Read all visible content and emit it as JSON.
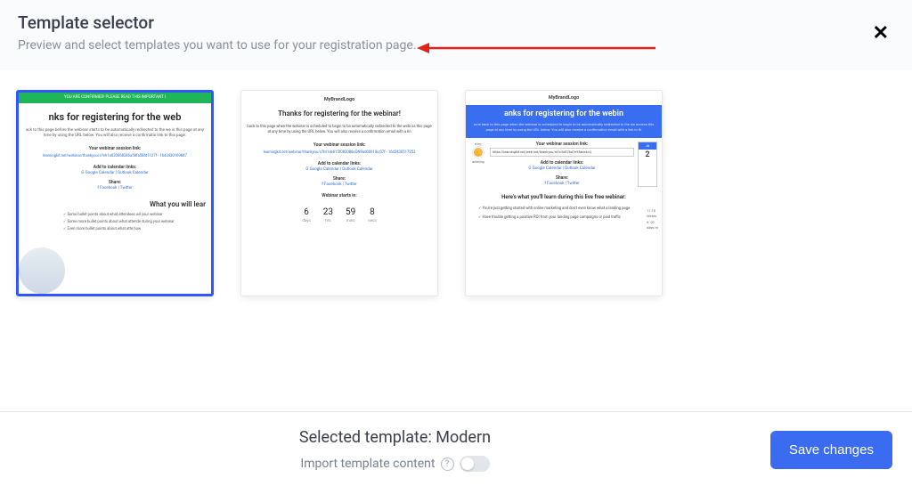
{
  "header": {
    "title": "Template selector",
    "subtitle": "Preview and select templates you want to use for your registration page."
  },
  "templates": [
    {
      "selected": true,
      "banner": "YOU ARE CONFIRMED! PLEASE READ THIS IMPORTANT I",
      "heading": "nks for registering for the web",
      "body": "ack to this page before the webinar starts to be automatically redirected to the we is this page at any time by using the URL below. You will also receive a confirmatio link to this page.",
      "link_label": "Your webinar session link:",
      "link_value": "learningkit.net/webinar/thankyou/s?eh1a620068246a58fa586t1127f - 1643430169847",
      "cal_label": "Add to calendar links:",
      "cal_links": "G Google Calendar  |  Outlook Calendar",
      "share_label": "Share:",
      "share_links": "f Facebook  |  Twitter",
      "learn": "What you will lear",
      "bullets": [
        "✓ Some bullet points about what attendees wil your webinar",
        "✓ Some more bullet points about what attende during your webinar",
        "✓ Even more bullet points about what atte how"
      ]
    },
    {
      "selected": false,
      "logo": "MyBrandLogo",
      "heading": "Thanks for registering for the webinar!",
      "body": "back to this page when the webinar is scheduled to begin to be automatically redirected to the webi ss this page at any time by using the URL below. You will also receive a confirmation email with a lin",
      "link_label": "Your webinar session link:",
      "link_value": "learningkit.net/webinar/thankyou/s?bt1de615f082086cON9ad00610ic07f - 1643430517253",
      "cal_label": "Add to calendar links:",
      "cal_links": "G Google Calendar  |  Outlook Calendar",
      "share_label": "Share:",
      "share_links": "f Facebook  |  Twitter",
      "starts_label": "Webinar starts in:",
      "countdown": [
        {
          "n": "6",
          "u": "days"
        },
        {
          "n": "23",
          "u": "hrs"
        },
        {
          "n": "59",
          "u": "mins"
        },
        {
          "n": "8",
          "u": "secs"
        }
      ]
    },
    {
      "selected": false,
      "logo": "MyBrandLogo",
      "heading": "anks for registering for the webin",
      "body": "ome back to this page when the webinar is scheduled to begin to be automatically redirected to the we access this page at any time by using the URL below. You will also receive a confirmation email with a link to th",
      "link_label": "Your webinar session link:",
      "link_value": "https://learningkit.net/web.net/thankyou/st1c2d876d7e95ace4cQ",
      "cal_label": "Add to calendar links:",
      "cal_links": "G Google Calendar  |  Outlook Calendar",
      "share_label": "Share:",
      "share_links": "f Facebook  |  Twitter",
      "hosted_by": "d by:",
      "host_sub": "arketing",
      "learn_head": "Here's what you'll learn during this live free webinar:",
      "bullets": [
        "✓ You're just getting started with online marketing and don't even know what a landing page",
        "✓ Have trouble getting a positive ROI from your landing page campaigns or paid traffic"
      ],
      "date_block_top": "JA",
      "date_block_num": "2",
      "side_time": "11:15",
      "side_webin": "Webin",
      "side_days": "6",
      "side_days_u": "days",
      "side_hrs": "20",
      "side_hrs_u": "hr"
    }
  ],
  "footer": {
    "selected_label": "Selected template: ",
    "selected_name": "Modern",
    "import_label": "Import template content",
    "save_label": "Save changes"
  }
}
